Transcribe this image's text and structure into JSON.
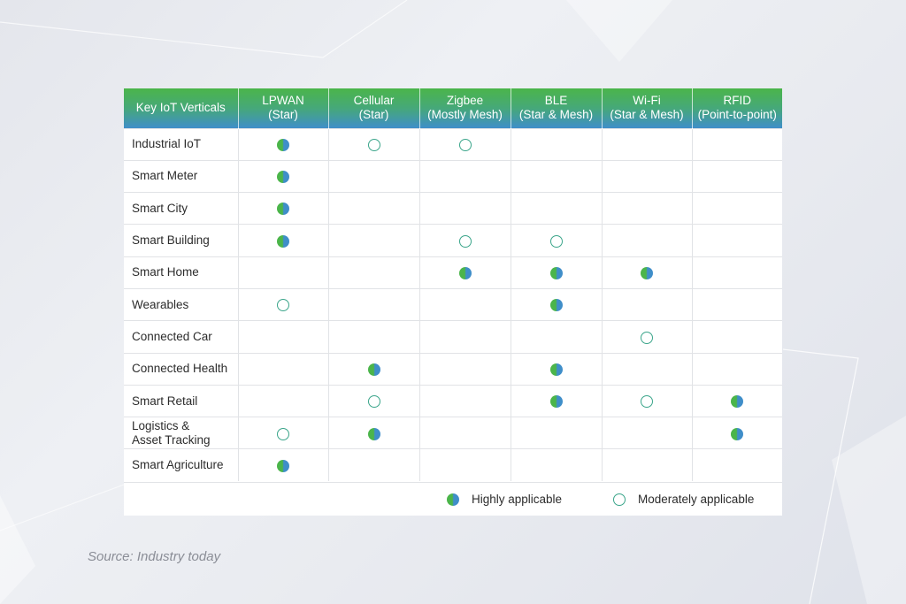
{
  "chart_data": {
    "type": "table",
    "columns": [
      {
        "line1": "Key IoT Verticals",
        "line2": ""
      },
      {
        "line1": "LPWAN",
        "line2": "(Star)"
      },
      {
        "line1": "Cellular",
        "line2": "(Star)"
      },
      {
        "line1": "Zigbee",
        "line2": "(Mostly Mesh)"
      },
      {
        "line1": "BLE",
        "line2": "(Star & Mesh)"
      },
      {
        "line1": "Wi-Fi",
        "line2": "(Star & Mesh)"
      },
      {
        "line1": "RFID",
        "line2": "(Point-to-point)"
      }
    ],
    "rows": [
      {
        "label": [
          "Industrial IoT"
        ],
        "cells": [
          "high",
          "moderate",
          "moderate",
          "",
          "",
          ""
        ]
      },
      {
        "label": [
          "Smart Meter"
        ],
        "cells": [
          "high",
          "",
          "",
          "",
          "",
          ""
        ]
      },
      {
        "label": [
          "Smart City"
        ],
        "cells": [
          "high",
          "",
          "",
          "",
          "",
          ""
        ]
      },
      {
        "label": [
          "Smart Building"
        ],
        "cells": [
          "high",
          "",
          "moderate",
          "moderate",
          "",
          ""
        ]
      },
      {
        "label": [
          "Smart Home"
        ],
        "cells": [
          "",
          "",
          "high",
          "high",
          "high",
          ""
        ]
      },
      {
        "label": [
          "Wearables"
        ],
        "cells": [
          "moderate",
          "",
          "",
          "high",
          "",
          ""
        ]
      },
      {
        "label": [
          "Connected Car"
        ],
        "cells": [
          "",
          "",
          "",
          "",
          "moderate",
          ""
        ]
      },
      {
        "label": [
          "Connected Health"
        ],
        "cells": [
          "",
          "high",
          "",
          "high",
          "",
          ""
        ]
      },
      {
        "label": [
          "Smart Retail"
        ],
        "cells": [
          "",
          "moderate",
          "",
          "high",
          "moderate",
          "high"
        ]
      },
      {
        "label": [
          "Logistics &",
          "Asset Tracking"
        ],
        "cells": [
          "moderate",
          "high",
          "",
          "",
          "",
          "high"
        ]
      },
      {
        "label": [
          "Smart Agriculture"
        ],
        "cells": [
          "high",
          "",
          "",
          "",
          "",
          ""
        ]
      }
    ],
    "legend": {
      "high": "Highly applicable",
      "moderate": "Moderately applicable"
    }
  },
  "source": "Source: Industry today",
  "colors": {
    "header_green": "#4bb54a",
    "header_blue": "#3f8ec9",
    "moderate_ring": "#3aa58a"
  }
}
